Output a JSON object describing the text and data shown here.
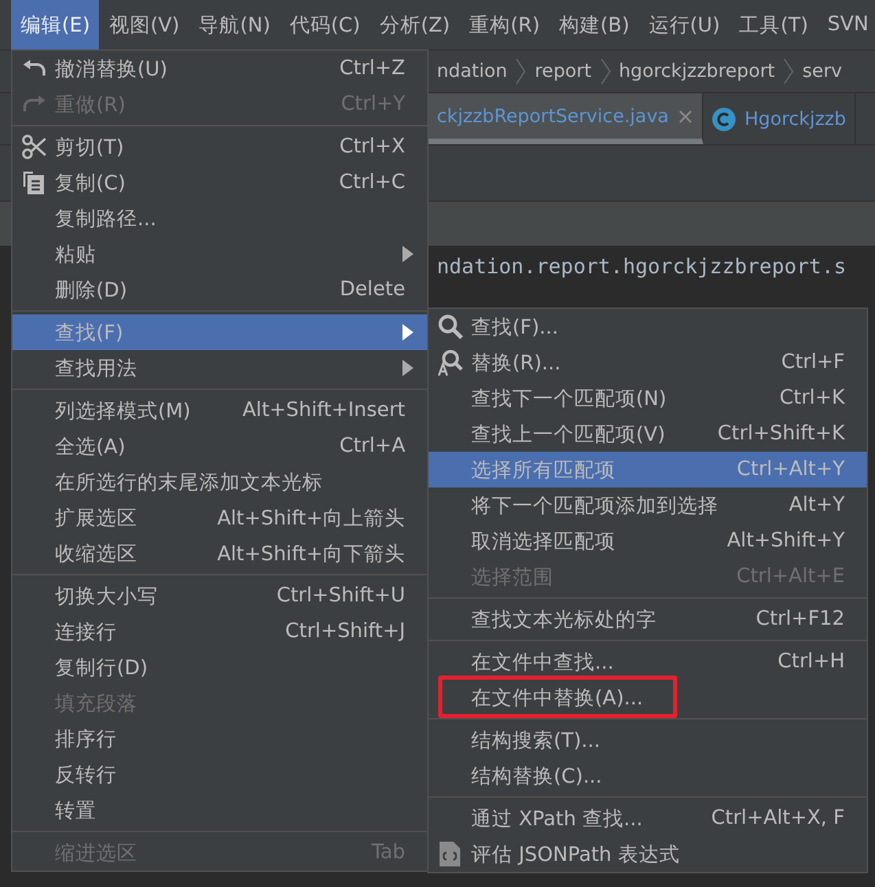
{
  "menubar": [
    {
      "label": "编辑(E)",
      "selected": true
    },
    {
      "label": "视图(V)",
      "selected": false
    },
    {
      "label": "导航(N)",
      "selected": false
    },
    {
      "label": "代码(C)",
      "selected": false
    },
    {
      "label": "分析(Z)",
      "selected": false
    },
    {
      "label": "重构(R)",
      "selected": false
    },
    {
      "label": "构建(B)",
      "selected": false
    },
    {
      "label": "运行(U)",
      "selected": false
    },
    {
      "label": "工具(T)",
      "selected": false
    },
    {
      "label": "SVN",
      "selected": false
    }
  ],
  "breadcrumbs": [
    "ndation",
    "report",
    "hgorckjzzbreport",
    "serv"
  ],
  "editor_tabs": [
    {
      "label": "ckjzzbReportService.java",
      "selected": true,
      "closable": true
    },
    {
      "label": "Hgorckjzzb",
      "selected": false,
      "closable": false
    }
  ],
  "code_line": "ndation.report.hgorckjzzbreport.s",
  "edit_menu": {
    "items": [
      {
        "kind": "item",
        "label": "撤消替换(U)",
        "shortcut": "Ctrl+Z",
        "disabled": false,
        "selected": false,
        "has_submenu": false
      },
      {
        "kind": "item",
        "label": "重做(R)",
        "shortcut": "Ctrl+Y",
        "disabled": true,
        "selected": false,
        "has_submenu": false
      },
      {
        "kind": "separator"
      },
      {
        "kind": "item",
        "label": "剪切(T)",
        "shortcut": "Ctrl+X",
        "disabled": false,
        "selected": false,
        "has_submenu": false
      },
      {
        "kind": "item",
        "label": "复制(C)",
        "shortcut": "Ctrl+C",
        "disabled": false,
        "selected": false,
        "has_submenu": false
      },
      {
        "kind": "item",
        "label": "复制路径...",
        "disabled": false,
        "selected": false,
        "has_submenu": false
      },
      {
        "kind": "item",
        "label": "粘贴",
        "disabled": false,
        "selected": false,
        "has_submenu": true
      },
      {
        "kind": "item",
        "label": "删除(D)",
        "shortcut": "Delete",
        "disabled": false,
        "selected": false,
        "has_submenu": false
      },
      {
        "kind": "separator"
      },
      {
        "kind": "item",
        "label": "查找(F)",
        "disabled": false,
        "selected": true,
        "has_submenu": true
      },
      {
        "kind": "item",
        "label": "查找用法",
        "disabled": false,
        "selected": false,
        "has_submenu": true
      },
      {
        "kind": "separator"
      },
      {
        "kind": "item",
        "label": "列选择模式(M)",
        "shortcut": "Alt+Shift+Insert",
        "disabled": false,
        "selected": false,
        "has_submenu": false
      },
      {
        "kind": "item",
        "label": "全选(A)",
        "shortcut": "Ctrl+A",
        "disabled": false,
        "selected": false,
        "has_submenu": false
      },
      {
        "kind": "item",
        "label": "在所选行的末尾添加文本光标",
        "disabled": false,
        "selected": false,
        "has_submenu": false
      },
      {
        "kind": "item",
        "label": "扩展选区",
        "shortcut": "Alt+Shift+向上箭头",
        "disabled": false,
        "selected": false,
        "has_submenu": false
      },
      {
        "kind": "item",
        "label": "收缩选区",
        "shortcut": "Alt+Shift+向下箭头",
        "disabled": false,
        "selected": false,
        "has_submenu": false
      },
      {
        "kind": "separator"
      },
      {
        "kind": "item",
        "label": "切换大小写",
        "shortcut": "Ctrl+Shift+U",
        "disabled": false,
        "selected": false,
        "has_submenu": false
      },
      {
        "kind": "item",
        "label": "连接行",
        "shortcut": "Ctrl+Shift+J",
        "disabled": false,
        "selected": false,
        "has_submenu": false
      },
      {
        "kind": "item",
        "label": "复制行(D)",
        "disabled": false,
        "selected": false,
        "has_submenu": false
      },
      {
        "kind": "item",
        "label": "填充段落",
        "disabled": true,
        "selected": false,
        "has_submenu": false
      },
      {
        "kind": "item",
        "label": "排序行",
        "disabled": false,
        "selected": false,
        "has_submenu": false
      },
      {
        "kind": "item",
        "label": "反转行",
        "disabled": false,
        "selected": false,
        "has_submenu": false
      },
      {
        "kind": "item",
        "label": "转置",
        "disabled": false,
        "selected": false,
        "has_submenu": false
      },
      {
        "kind": "separator"
      },
      {
        "kind": "item",
        "label": "缩进选区",
        "shortcut": "Tab",
        "disabled": true,
        "selected": false,
        "has_submenu": false
      }
    ]
  },
  "find_submenu": {
    "items": [
      {
        "kind": "item",
        "label": "查找(F)...",
        "disabled": false,
        "selected": false,
        "highlighted": false
      },
      {
        "kind": "item",
        "label": "替换(R)...",
        "shortcut": "Ctrl+F",
        "disabled": false,
        "selected": false,
        "highlighted": false
      },
      {
        "kind": "item",
        "label": "查找下一个匹配项(N)",
        "shortcut": "Ctrl+K",
        "disabled": false,
        "selected": false,
        "highlighted": false
      },
      {
        "kind": "item",
        "label": "查找上一个匹配项(V)",
        "shortcut": "Ctrl+Shift+K",
        "disabled": false,
        "selected": false,
        "highlighted": false
      },
      {
        "kind": "item",
        "label": "选择所有匹配项",
        "shortcut": "Ctrl+Alt+Y",
        "disabled": false,
        "selected": true,
        "highlighted": false
      },
      {
        "kind": "item",
        "label": "将下一个匹配项添加到选择",
        "shortcut": "Alt+Y",
        "disabled": false,
        "selected": false,
        "highlighted": false
      },
      {
        "kind": "item",
        "label": "取消选择匹配项",
        "shortcut": "Alt+Shift+Y",
        "disabled": false,
        "selected": false,
        "highlighted": false
      },
      {
        "kind": "item",
        "label": "选择范围",
        "shortcut": "Ctrl+Alt+E",
        "disabled": true,
        "selected": false,
        "highlighted": false
      },
      {
        "kind": "separator"
      },
      {
        "kind": "item",
        "label": "查找文本光标处的字",
        "shortcut": "Ctrl+F12",
        "disabled": false,
        "selected": false,
        "highlighted": false
      },
      {
        "kind": "separator"
      },
      {
        "kind": "item",
        "label": "在文件中查找...",
        "shortcut": "Ctrl+H",
        "disabled": false,
        "selected": false,
        "highlighted": false
      },
      {
        "kind": "item",
        "label": "在文件中替换(A)...",
        "disabled": false,
        "selected": false,
        "highlighted": true
      },
      {
        "kind": "separator"
      },
      {
        "kind": "item",
        "label": "结构搜索(T)...",
        "disabled": false,
        "selected": false,
        "highlighted": false
      },
      {
        "kind": "item",
        "label": "结构替换(C)...",
        "disabled": false,
        "selected": false,
        "highlighted": false
      },
      {
        "kind": "separator"
      },
      {
        "kind": "item",
        "label": "通过 XPath 查找...",
        "shortcut": "Ctrl+Alt+X, F",
        "disabled": false,
        "selected": false,
        "highlighted": false
      },
      {
        "kind": "item",
        "label": "评估 JSONPath 表达式",
        "disabled": false,
        "selected": false,
        "highlighted": false
      }
    ]
  }
}
